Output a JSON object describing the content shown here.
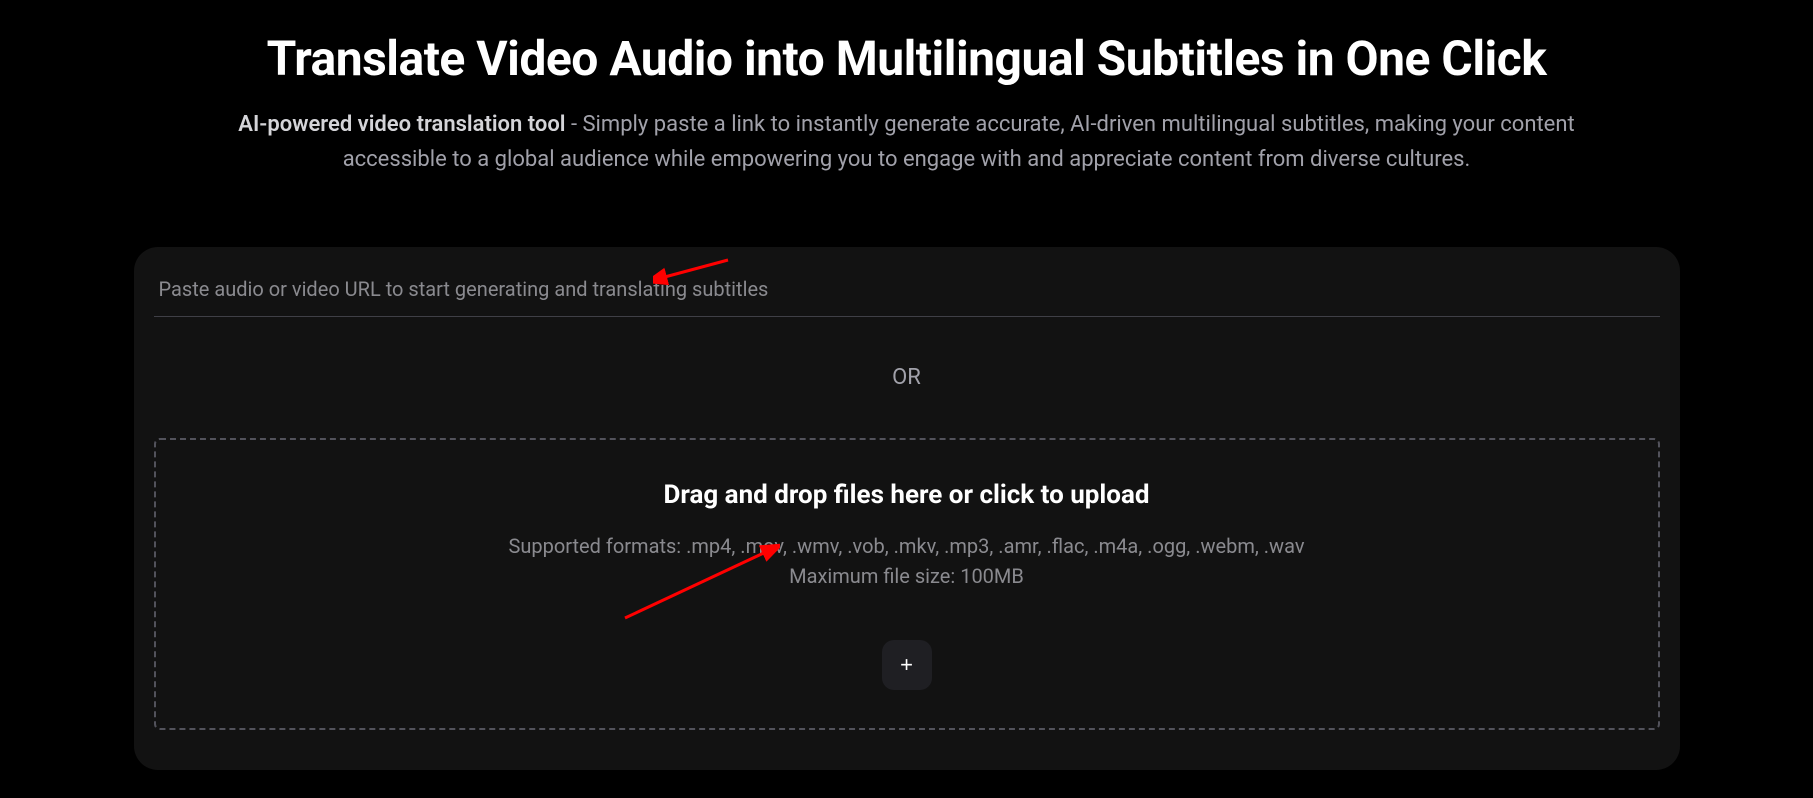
{
  "header": {
    "title": "Translate Video Audio into Multilingual Subtitles in One Click",
    "subtitle_bold": "AI-powered video translation tool",
    "subtitle_rest": " - Simply paste a link to instantly generate accurate, AI-driven multilingual subtitles, making your content accessible to a global audience while empowering you to engage with and appreciate content from diverse cultures."
  },
  "input": {
    "url_placeholder": "Paste audio or video URL to start generating and translating subtitles"
  },
  "divider": {
    "or_text": "OR"
  },
  "dropzone": {
    "title": "Drag and drop files here or click to upload",
    "formats": "Supported formats: .mp4, .mov, .wmv, .vob, .mkv, .mp3, .amr, .flac, .m4a, .ogg, .webm, .wav",
    "max_size": "Maximum file size: 100MB",
    "add_icon": "+"
  }
}
